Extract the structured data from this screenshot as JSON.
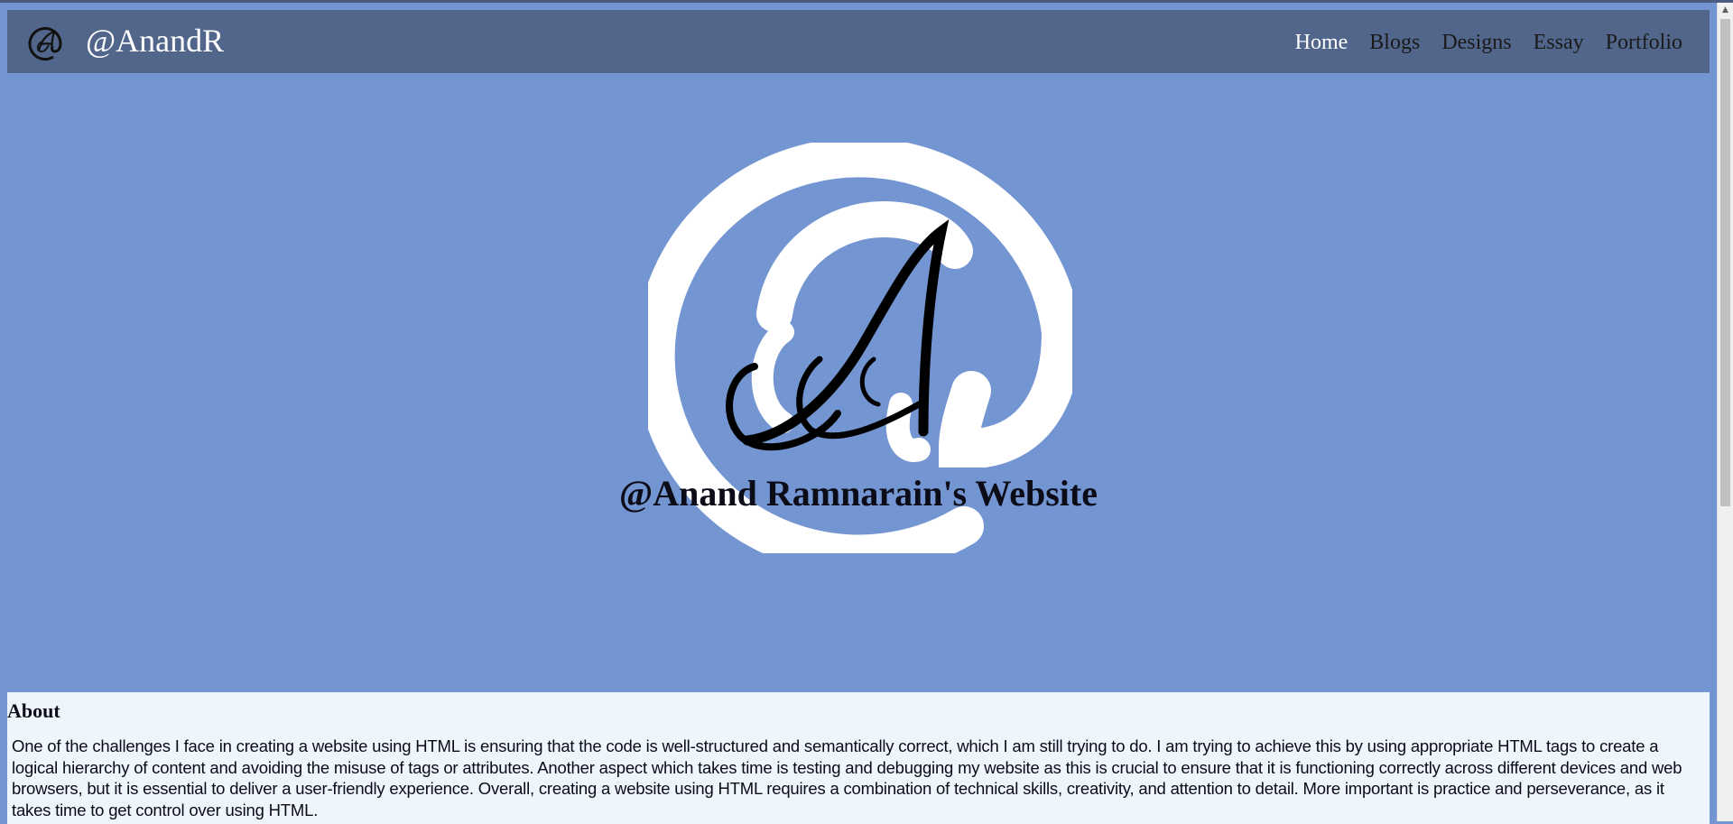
{
  "header": {
    "brand": "@AnandR",
    "logo_icon": "at-a-monogram-icon",
    "nav": [
      {
        "label": "Home",
        "active": true
      },
      {
        "label": "Blogs",
        "active": false
      },
      {
        "label": "Designs",
        "active": false
      },
      {
        "label": "Essay",
        "active": false
      },
      {
        "label": "Portfolio",
        "active": false
      }
    ]
  },
  "hero": {
    "logo_icon": "at-a-monogram-icon",
    "title": "@Anand Ramnarain's Website"
  },
  "about": {
    "heading": "About",
    "text": "One of the challenges I face in creating a website using HTML is ensuring that the code is well-structured and semantically correct, which I am still trying to do. I am trying to achieve this by using appropriate HTML tags to create a logical hierarchy of content and avoiding the misuse of tags or attributes. Another aspect which takes time is testing and debugging my website as this is crucial to ensure that it is functioning correctly across different devices and web browsers, but it is essential to deliver a user-friendly experience. Overall, creating a website using HTML requires a combination of technical skills, creativity, and attention to detail. More important is practice and perseverance, as it takes time to get control over using HTML."
  },
  "colors": {
    "page_bg": "#7395d2",
    "navbar_bg": "#52668b",
    "about_bg": "#eef5fd",
    "text_dark": "#0c0c18"
  }
}
